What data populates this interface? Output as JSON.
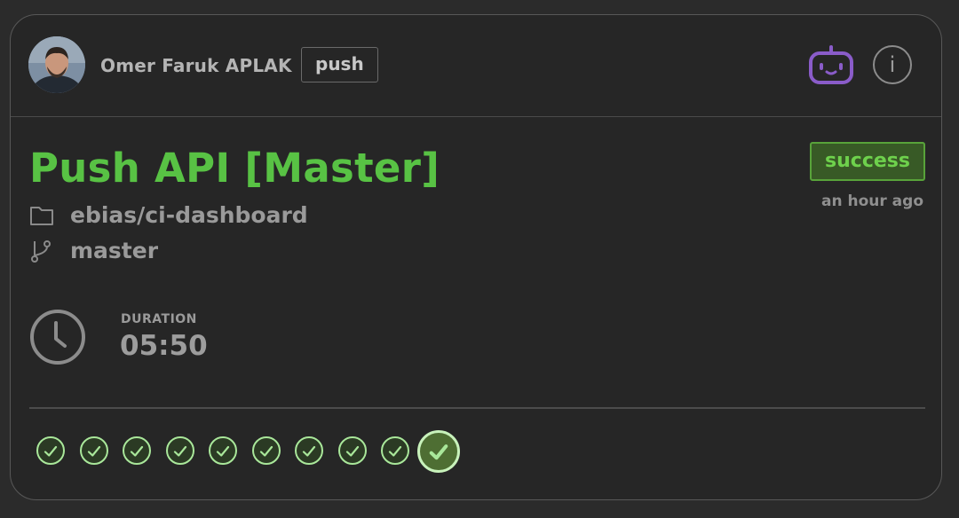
{
  "header": {
    "author": "Omer Faruk APLAK",
    "event": "push",
    "bot_icon": "bot-face-icon",
    "info_label": "i"
  },
  "build": {
    "title": "Push API [Master]",
    "status": "success",
    "time_ago": "an hour ago",
    "repository": "ebias/ci-dashboard",
    "branch": "master"
  },
  "duration": {
    "label": "DURATION",
    "value": "05:50"
  },
  "history": {
    "runs": [
      "success",
      "success",
      "success",
      "success",
      "success",
      "success",
      "success",
      "success",
      "success",
      "success"
    ],
    "current_index": 9
  },
  "colors": {
    "success_green": "#58c244",
    "bot_purple": "#8a5cc9",
    "background": "#262626"
  }
}
